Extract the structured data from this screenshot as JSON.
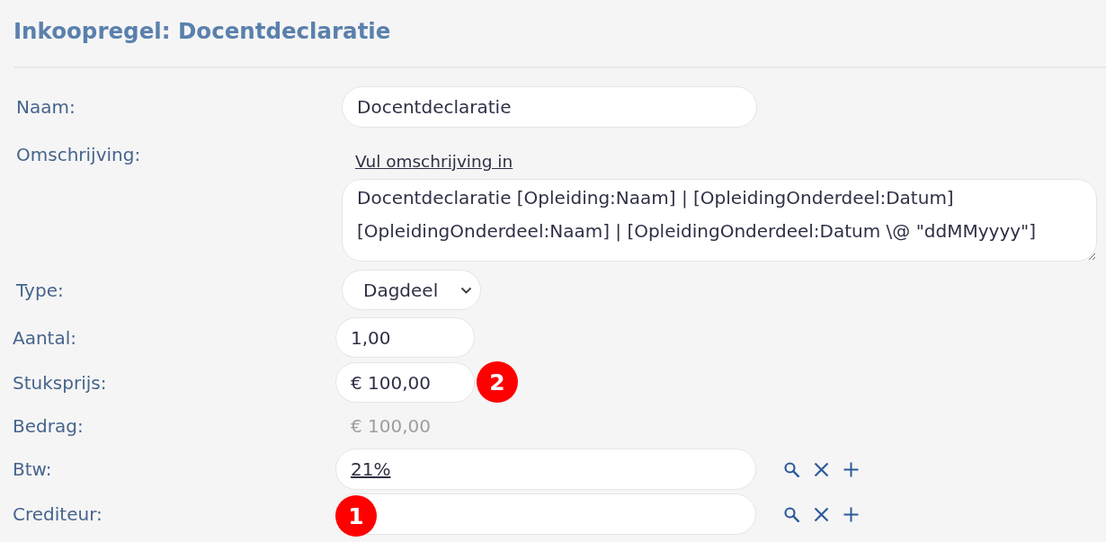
{
  "title": "Inkoopregel: Docentdeclaratie",
  "sections": [
    {
      "rows": [
        {
          "kind": "text",
          "label": "Naam:",
          "value": "Docentdeclaratie"
        },
        {
          "kind": "memo",
          "label": "Omschrijving:",
          "link": "Vul omschrijving in",
          "value": "Docentdeclaratie [Opleiding:Naam] | [OpleidingOnderdeel:Datum] [OpleidingOnderdeel:Naam] | [OpleidingOnderdeel:Datum \\@ \"ddMMyyyy\"]"
        },
        {
          "kind": "select",
          "label": "Type:",
          "value": "Dagdeel"
        }
      ]
    },
    {
      "rows": [
        {
          "kind": "number",
          "label": "Aantal:",
          "value": "1,00"
        },
        {
          "kind": "number",
          "label": "Stuksprijs:",
          "value": "€ 100,00",
          "callout": "2"
        },
        {
          "kind": "readonly",
          "label": "Bedrag:",
          "value": "€ 100,00"
        },
        {
          "kind": "lookup",
          "label": "Btw:",
          "value": "21%"
        },
        {
          "kind": "lookup",
          "label": "Crediteur:",
          "callout": "1"
        }
      ]
    }
  ]
}
